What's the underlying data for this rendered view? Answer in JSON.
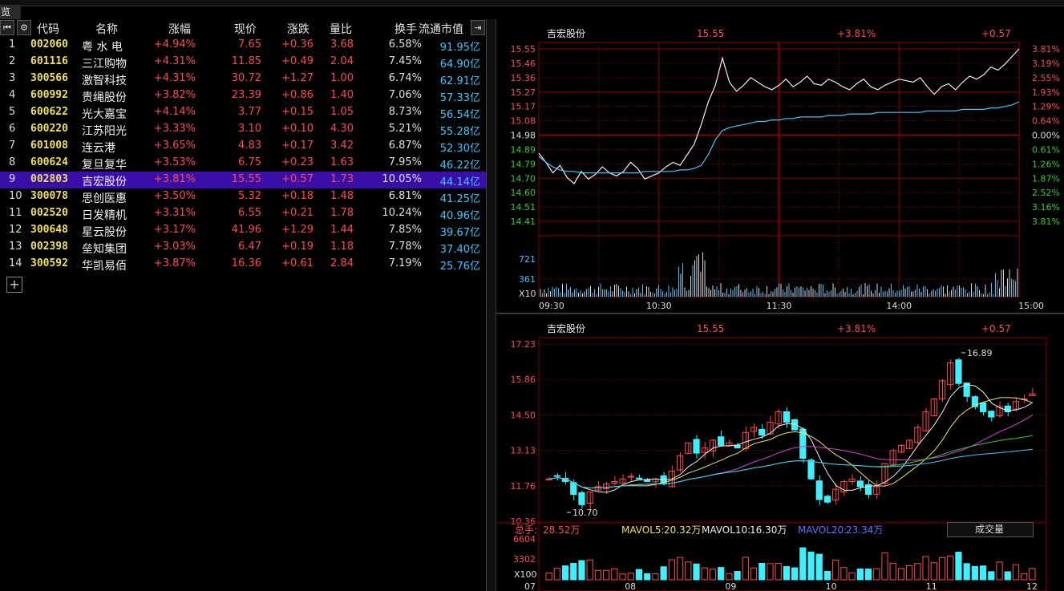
{
  "tab_label": "览",
  "list": {
    "headers": {
      "code": "代码",
      "name": "名称",
      "pct": "涨幅",
      "price": "现价",
      "chg": "涨跌",
      "vr": "量比",
      "tr": "换手",
      "mc": "流通市值"
    },
    "rows": [
      {
        "idx": "1",
        "code": "002060",
        "name": "粤 水 电",
        "pct": "+4.94%",
        "price": "7.65",
        "chg": "+0.36",
        "vr": "3.68",
        "tr": "6.58%",
        "mc": "91.95亿"
      },
      {
        "idx": "2",
        "code": "601116",
        "name": "三江购物",
        "pct": "+4.31%",
        "price": "11.85",
        "chg": "+0.49",
        "vr": "2.04",
        "tr": "7.45%",
        "mc": "64.90亿"
      },
      {
        "idx": "3",
        "code": "300566",
        "name": "激智科技",
        "pct": "+4.31%",
        "price": "30.72",
        "chg": "+1.27",
        "vr": "1.00",
        "tr": "6.74%",
        "mc": "62.91亿"
      },
      {
        "idx": "4",
        "code": "600992",
        "name": "贵绳股份",
        "pct": "+3.82%",
        "price": "23.39",
        "chg": "+0.86",
        "vr": "1.40",
        "tr": "7.06%",
        "mc": "57.33亿"
      },
      {
        "idx": "5",
        "code": "600622",
        "name": "光大嘉宝",
        "pct": "+4.14%",
        "price": "3.77",
        "chg": "+0.15",
        "vr": "1.05",
        "tr": "8.73%",
        "mc": "56.54亿"
      },
      {
        "idx": "6",
        "code": "600220",
        "name": "江苏阳光",
        "pct": "+3.33%",
        "price": "3.10",
        "chg": "+0.10",
        "vr": "4.30",
        "tr": "5.21%",
        "mc": "55.28亿"
      },
      {
        "idx": "7",
        "code": "601008",
        "name": "连云港",
        "pct": "+3.65%",
        "price": "4.83",
        "chg": "+0.17",
        "vr": "3.42",
        "tr": "6.87%",
        "mc": "52.30亿"
      },
      {
        "idx": "8",
        "code": "600624",
        "name": "复旦复华",
        "pct": "+3.53%",
        "price": "6.75",
        "chg": "+0.23",
        "vr": "1.63",
        "tr": "7.95%",
        "mc": "46.22亿"
      },
      {
        "idx": "9",
        "code": "002803",
        "name": "吉宏股份",
        "pct": "+3.81%",
        "price": "15.55",
        "chg": "+0.57",
        "vr": "1.73",
        "tr": "10.05%",
        "mc": "44.14亿",
        "selected": true
      },
      {
        "idx": "10",
        "code": "300078",
        "name": "思创医惠",
        "pct": "+3.50%",
        "price": "5.32",
        "chg": "+0.18",
        "vr": "1.48",
        "tr": "6.81%",
        "mc": "41.25亿"
      },
      {
        "idx": "11",
        "code": "002520",
        "name": "日发精机",
        "pct": "+3.31%",
        "price": "6.55",
        "chg": "+0.21",
        "vr": "1.78",
        "tr": "10.24%",
        "mc": "40.96亿"
      },
      {
        "idx": "12",
        "code": "300648",
        "name": "星云股份",
        "pct": "+3.17%",
        "price": "41.96",
        "chg": "+1.29",
        "vr": "1.44",
        "tr": "7.85%",
        "mc": "39.67亿"
      },
      {
        "idx": "13",
        "code": "002398",
        "name": "垒知集团",
        "pct": "+3.03%",
        "price": "6.47",
        "chg": "+0.19",
        "vr": "1.18",
        "tr": "7.78%",
        "mc": "37.40亿"
      },
      {
        "idx": "14",
        "code": "300592",
        "name": "华凯易佰",
        "pct": "+3.87%",
        "price": "16.36",
        "chg": "+0.61",
        "vr": "2.84",
        "tr": "7.19%",
        "mc": "25.76亿"
      }
    ]
  },
  "quote": {
    "name": "吉宏股份",
    "price": "15.55",
    "pct": "+3.81%",
    "chg": "+0.57"
  },
  "colors": {
    "up": "#ff4a4a",
    "down": "#3cf0ff",
    "code": "#f0e060",
    "grid": "#8a0000",
    "selected": "#3a0ea8",
    "avg": "#3cc8ff"
  },
  "chart_data": [
    {
      "type": "line",
      "price_ticks_left": [
        "15.55",
        "15.46",
        "15.36",
        "15.27",
        "15.17",
        "15.08",
        "14.98",
        "14.89",
        "14.79",
        "14.70",
        "14.60",
        "14.51",
        "14.41"
      ],
      "pct_ticks_right": [
        "3.81%",
        "3.19%",
        "2.55%",
        "1.93%",
        "1.29%",
        "0.64%",
        "0.00%",
        "0.61%",
        "1.26%",
        "1.87%",
        "2.52%",
        "3.16%",
        "3.81%"
      ],
      "volume_ticks": [
        "721",
        "361"
      ],
      "volume_unit": "X10",
      "x_ticks": [
        "09:30",
        "10:30",
        "11:30",
        "14:00",
        "15:00"
      ],
      "ylim": [
        14.41,
        15.55
      ],
      "prev_close": 14.98,
      "series": [
        {
          "values": [
            14.86,
            14.8,
            14.73,
            14.78,
            14.7,
            14.66,
            14.74,
            14.69,
            14.72,
            14.77,
            14.73,
            14.71,
            14.74,
            14.8,
            14.76,
            14.69,
            14.71,
            14.73,
            14.77,
            14.8,
            14.78,
            14.85,
            14.92,
            15.05,
            15.2,
            15.31,
            15.49,
            15.33,
            15.27,
            15.31,
            15.36,
            15.33,
            15.3,
            15.28,
            15.31,
            15.35,
            15.3,
            15.33,
            15.37,
            15.32,
            15.31,
            15.35,
            15.33,
            15.3,
            15.28,
            15.32,
            15.35,
            15.3,
            15.28,
            15.31,
            15.33,
            15.35,
            15.34,
            15.33,
            15.36,
            15.3,
            15.25,
            15.3,
            15.32,
            15.28,
            15.33,
            15.37,
            15.35,
            15.38,
            15.43,
            15.41,
            15.45,
            15.5,
            15.55
          ]
        },
        {
          "values": [
            14.84,
            14.8,
            14.77,
            14.75,
            14.74,
            14.74,
            14.73,
            14.73,
            14.73,
            14.73,
            14.73,
            14.73,
            14.73,
            14.73,
            14.73,
            14.74,
            14.74,
            14.74,
            14.74,
            14.74,
            14.75,
            14.75,
            14.76,
            14.78,
            14.85,
            14.95,
            15.01,
            15.03,
            15.04,
            15.05,
            15.06,
            15.07,
            15.07,
            15.08,
            15.08,
            15.09,
            15.09,
            15.1,
            15.1,
            15.1,
            15.1,
            15.11,
            15.11,
            15.11,
            15.12,
            15.12,
            15.12,
            15.12,
            15.13,
            15.13,
            15.13,
            15.13,
            15.13,
            15.13,
            15.13,
            15.14,
            15.14,
            15.14,
            15.14,
            15.14,
            15.15,
            15.15,
            15.15,
            15.15,
            15.16,
            15.16,
            15.17,
            15.18,
            15.2
          ]
        }
      ]
    },
    {
      "type": "bar",
      "title_bar": {
        "label": "总手:",
        "value": "28.52万",
        "ma5_label": "MAVOL5:",
        "ma5": "20.32万",
        "ma10_label": "MAVOL10:",
        "ma10": "16.30万",
        "ma20_label": "MAVOL20:",
        "ma20": "23.34万"
      },
      "price_ticks": [
        "17.23",
        "15.86",
        "14.50",
        "13.13",
        "11.76",
        "10.36"
      ],
      "ylim": [
        10.36,
        17.23
      ],
      "annotations": [
        {
          "text": "16.89",
          "value": 16.89
        },
        {
          "text": "10.70",
          "value": 10.7
        }
      ],
      "volume_ticks": [
        "6604",
        "3302"
      ],
      "volume_unit": "X100",
      "x_ticks": [
        "07",
        "08",
        "09",
        "10",
        "11",
        "12"
      ],
      "dropdown": "成交量"
    }
  ]
}
